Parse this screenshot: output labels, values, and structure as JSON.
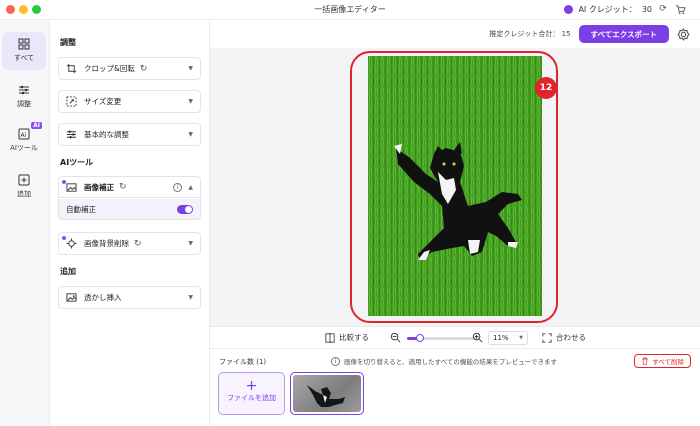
{
  "window": {
    "title": "一括画像エディター"
  },
  "header": {
    "credits_label": "AI クレジット：",
    "credits_value": "30"
  },
  "nav": {
    "items": [
      {
        "label": "すべて",
        "icon": "grid-icon"
      },
      {
        "label": "調整",
        "icon": "sliders-icon"
      },
      {
        "label": "AIツール",
        "icon": "ai-icon",
        "badge": "AI"
      },
      {
        "label": "追加",
        "icon": "plus-square-icon"
      }
    ]
  },
  "panel": {
    "section_adjust": "調整",
    "section_ai": "AIツール",
    "section_add": "追加",
    "tools": {
      "crop": "クロップ&回転",
      "resize": "サイズ変更",
      "basic": "基本的な調整",
      "enhance": "画像補正",
      "auto_enhance": "自動補正",
      "bg_remove": "画像背景削除",
      "watermark": "透かし挿入"
    }
  },
  "toolbar": {
    "estimated_label": "推定クレジット合計：",
    "estimated_value": "15",
    "export_label": "すべてエクスポート"
  },
  "canvas": {
    "badge": "12"
  },
  "zoom": {
    "compare_label": "比較する",
    "zoom_value": "11%",
    "zoom_fraction": 0.18,
    "fit_label": "合わせる"
  },
  "files": {
    "count_label": "ファイル数 (1)",
    "hint": "画像を切り替えると、適用したすべての機能の結果をプレビューできます",
    "delete_all": "すべて削除",
    "add_file": "ファイルを追加"
  },
  "colors": {
    "accent": "#7b3fe4",
    "danger": "#e0242a",
    "grass": "#3f9a1e"
  }
}
